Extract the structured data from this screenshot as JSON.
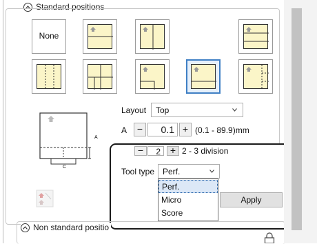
{
  "standard_section": {
    "title": "Standard positions"
  },
  "positions": {
    "none_label": "None",
    "tiles": [
      {
        "name": "none",
        "selected": false
      },
      {
        "name": "top",
        "selected": false
      },
      {
        "name": "center-vertical",
        "selected": false
      },
      {
        "name": "horizontal-lines",
        "selected": false
      },
      {
        "name": "vertical-three",
        "selected": false
      },
      {
        "name": "grid",
        "selected": false
      },
      {
        "name": "bottom-left",
        "selected": false
      },
      {
        "name": "bottom-full",
        "selected": true
      },
      {
        "name": "right-side",
        "selected": false
      }
    ]
  },
  "layout": {
    "label": "Layout",
    "value": "Top"
  },
  "a_row": {
    "label": "A",
    "minus": "−",
    "value": "0.1",
    "plus": "+",
    "range": "(0.1 - 89.9)mm"
  },
  "c_row": {
    "label": "C",
    "minus": "−",
    "value": "2",
    "plus": "+",
    "range": "2 - 3 division"
  },
  "tool_type": {
    "label": "Tool type",
    "value": "Perf.",
    "options": [
      "Perf.",
      "Micro",
      "Score"
    ]
  },
  "apply_label": "Apply",
  "diagram": {
    "a": "A",
    "c": "C"
  },
  "non_standard_section": {
    "title": "Non standard positio"
  },
  "colors": {
    "tile_fill": "#fbf5c8",
    "selected_border": "#3f7fc4"
  }
}
